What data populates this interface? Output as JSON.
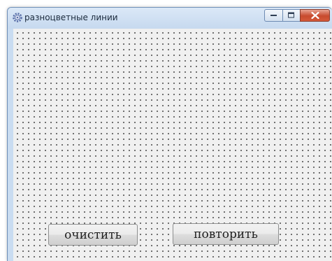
{
  "window": {
    "title": "разноцветные линии",
    "icon": "app-gear-icon",
    "controls": [
      "minimize-icon",
      "maximize-icon",
      "close-icon"
    ],
    "close_color": "#c84a2e"
  },
  "form": {
    "grid": "dotted",
    "buttons": {
      "clear_label": "очистить",
      "repeat_label": "повторить"
    }
  }
}
